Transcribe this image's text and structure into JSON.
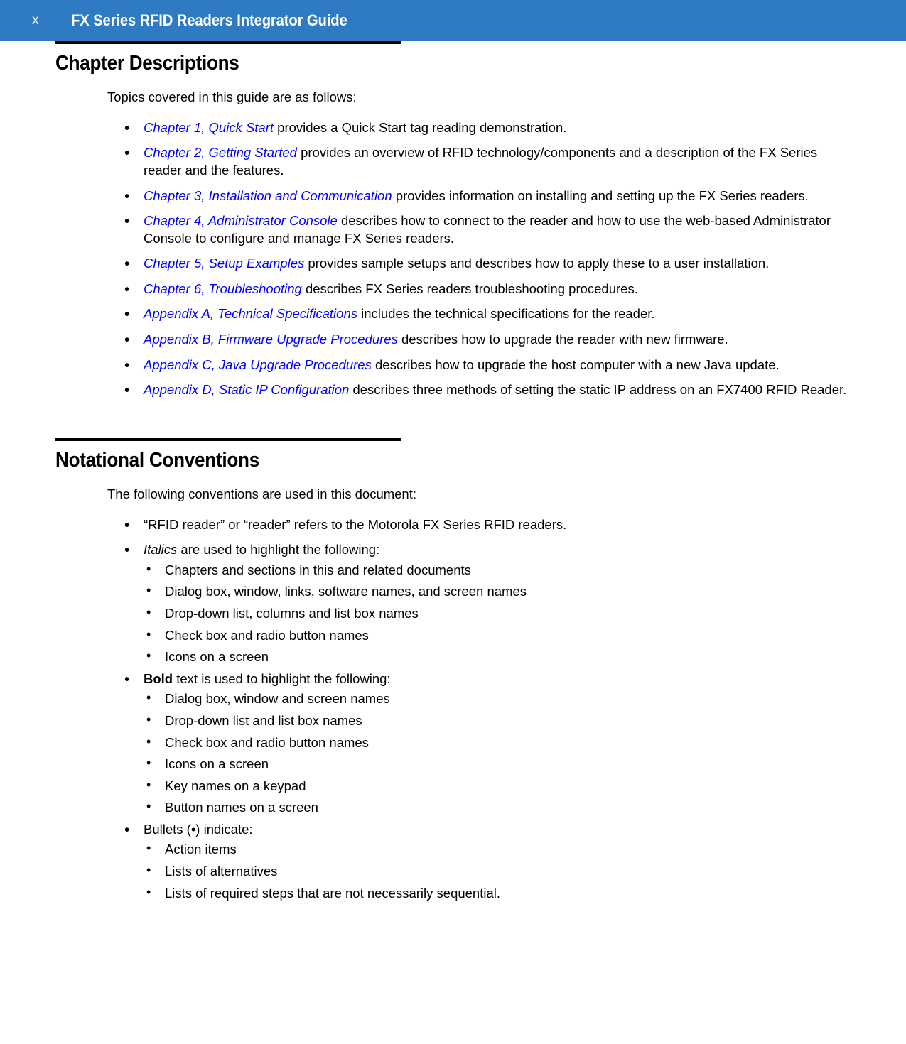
{
  "header": {
    "folio": "x",
    "title": "FX Series RFID Readers Integrator Guide",
    "bar_color": "#2E7BC4",
    "text_color": "#ffffff"
  },
  "colors": {
    "xref_link": "#0000FF",
    "body_text": "#000000",
    "rule": "#000000"
  },
  "sections": {
    "chapter_descriptions": {
      "title": "Chapter Descriptions",
      "lead": "Topics covered in this guide are as follows:",
      "items": [
        {
          "xref": "Chapter 1, Quick Start",
          "text": " provides a Quick Start tag reading demonstration."
        },
        {
          "xref": "Chapter 2, Getting Started",
          "text": " provides an overview of RFID technology/components and a description of the FX Series reader and the features."
        },
        {
          "xref": "Chapter 3, Installation and Communication",
          "text": " provides information on installing and setting up the FX Series readers."
        },
        {
          "xref": "Chapter 4, Administrator Console",
          "text": " describes how to connect to the reader and how to use the web-based Administrator Console to configure and manage FX Series readers."
        },
        {
          "xref": "Chapter 5, Setup Examples",
          "text": " provides sample setups and describes how to apply these to a user installation."
        },
        {
          "xref": "Chapter 6, Troubleshooting",
          "text": " describes FX Series readers troubleshooting procedures."
        },
        {
          "xref": "Appendix A, Technical Specifications",
          "text": " includes the technical specifications for the reader."
        },
        {
          "xref": "Appendix B, Firmware Upgrade Procedures",
          "text": " describes how to upgrade the reader with new firmware."
        },
        {
          "xref": "Appendix C, Java Upgrade Procedures",
          "text": " describes how to upgrade the host computer with a new Java update."
        },
        {
          "xref": "Appendix D, Static IP Configuration",
          "text": " describes three methods of setting the static IP address on an FX7400 RFID Reader."
        }
      ]
    },
    "notational_conventions": {
      "title": "Notational Conventions",
      "lead": "The following conventions are used in this document:",
      "items": [
        {
          "emphasis": "",
          "emphasis_style": "none",
          "text": "“RFID reader” or “reader” refers to the Motorola FX Series RFID readers.",
          "sub_items": []
        },
        {
          "emphasis": "Italics",
          "emphasis_style": "italic",
          "text": " are used to highlight the following:",
          "sub_items": [
            "Chapters and sections in this and related documents",
            "Dialog box, window, links, software names, and screen names",
            "Drop-down list, columns and list box names",
            "Check box and radio button names",
            "Icons on a screen"
          ]
        },
        {
          "emphasis": "Bold",
          "emphasis_style": "bold",
          "text": " text is used to highlight the following:",
          "sub_items": [
            "Dialog box, window and screen names",
            "Drop-down list and list box names",
            "Check box and radio button names",
            "Icons on a screen",
            "Key names on a keypad",
            "Button names on a screen"
          ]
        },
        {
          "emphasis": "",
          "emphasis_style": "none",
          "text": "Bullets (•) indicate:",
          "sub_items": [
            "Action items",
            "Lists of alternatives",
            "Lists of required steps that are not necessarily sequential."
          ]
        }
      ]
    }
  }
}
